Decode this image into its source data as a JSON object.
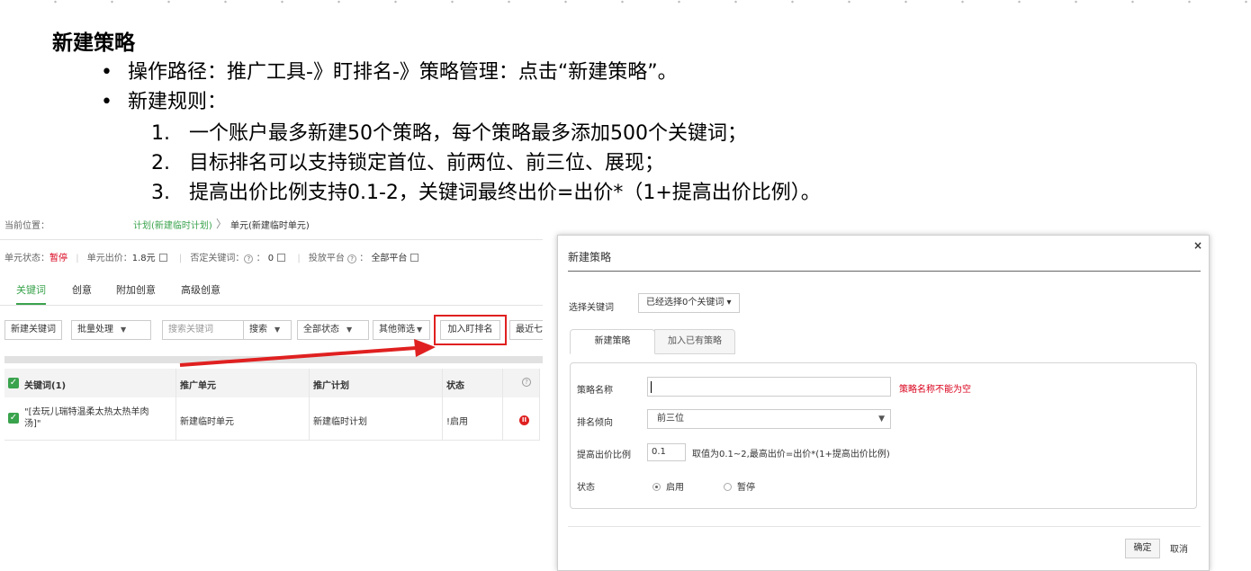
{
  "slide": {
    "title": "新建策略",
    "bullets": [
      {
        "dot": "•",
        "text": "操作路径：推广工具-》盯排名-》策略管理：点击“新建策略”。"
      },
      {
        "dot": "•",
        "text": "新建规则："
      }
    ],
    "rules": [
      {
        "n": "1.",
        "text": "一个账户最多新建50个策略，每个策略最多添加500个关键词；"
      },
      {
        "n": "2.",
        "text": "目标排名可以支持锁定首位、前两位、前三位、展现；"
      },
      {
        "n": "3.",
        "text": "提高出价比例支持0.1-2，关键词最终出价=出价*（1+提高出价比例）。"
      }
    ]
  },
  "app": {
    "breadcrumb": {
      "label": "当前位置：",
      "plan": "计划(新建临时计划)",
      "sep": "〉",
      "unit": "单元(新建临时单元)"
    },
    "status_row": {
      "state_label": "单元状态：",
      "state_value": "暂停",
      "bid_label": "单元出价：",
      "bid_value": "1.8元",
      "neg_label": "否定关键词：",
      "neg_value": "0",
      "platform_label": "投放平台",
      "platform_value": "全部平台",
      "help_glyph": "?"
    },
    "tabs": [
      "关键词",
      "创意",
      "附加创意",
      "高级创意"
    ],
    "toolbar": {
      "new_keyword": "新建关键词",
      "batch": "批量处理",
      "search_placeholder": "搜索关键词",
      "search": "搜索",
      "all_status": "全部状态",
      "other_filter": "其他筛选",
      "add_rank": "加入盯排名",
      "recent": "最近七"
    },
    "table": {
      "headers": [
        "关键词(1)",
        "推广单元",
        "推广计划",
        "状态"
      ],
      "rows": [
        {
          "keyword": "\"[去玩儿瑞特温柔太热太热羊肉汤]\"",
          "unit": "新建临时单元",
          "plan": "新建临时计划",
          "status": "!启用"
        }
      ]
    }
  },
  "dialog": {
    "title": "新建策略",
    "close": "×",
    "select_keyword_label": "选择关键词",
    "select_keyword_value": "已经选择0个关键词 ▾",
    "tabs": [
      "新建策略",
      "加入已有策略"
    ],
    "name_label": "策略名称",
    "name_error": "策略名称不能为空",
    "rank_label": "排名倾向",
    "rank_value": "前三位",
    "ratio_label": "提高出价比例",
    "ratio_value": "0.1",
    "ratio_note": "取值为0.1~2,最高出价=出价*(1+提高出价比例)",
    "status_label": "状态",
    "status_on": "启用",
    "status_off": "暂停",
    "ok": "确定",
    "cancel": "取消"
  },
  "colors": {
    "accent_green": "#3aa34d",
    "highlight_red": "#e02020",
    "error_red": "#d9001b"
  }
}
